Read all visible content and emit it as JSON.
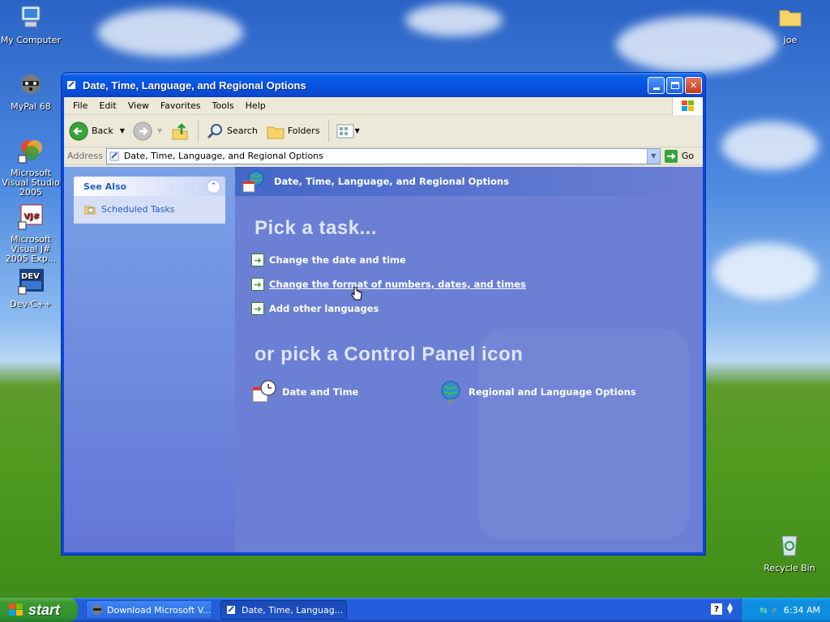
{
  "desktop": {
    "icons": [
      {
        "label": "My Computer"
      },
      {
        "label": "MyPal 68"
      },
      {
        "label": "Microsoft Visual Studio 2005"
      },
      {
        "label": "Microsoft Visual J# 2005 Exp..."
      },
      {
        "label": "Dev-C++"
      },
      {
        "label": "joe"
      },
      {
        "label": "Recycle Bin"
      }
    ]
  },
  "window": {
    "title": "Date, Time, Language, and Regional Options",
    "menu": [
      "File",
      "Edit",
      "View",
      "Favorites",
      "Tools",
      "Help"
    ],
    "toolbar": {
      "back": "Back",
      "search": "Search",
      "folders": "Folders"
    },
    "address": {
      "label": "Address",
      "value": "Date, Time, Language, and Regional Options",
      "go": "Go"
    },
    "see_also": {
      "title": "See Also",
      "items": [
        "Scheduled Tasks"
      ]
    },
    "main": {
      "header": "Date, Time, Language, and Regional Options",
      "pick_task": "Pick a task...",
      "tasks": [
        "Change the date and time",
        "Change the format of numbers, dates, and times",
        "Add other languages"
      ],
      "pick_icon": "or pick a Control Panel icon",
      "icons": [
        "Date and Time",
        "Regional and Language Options"
      ]
    }
  },
  "taskbar": {
    "start": "start",
    "buttons": [
      "Download Microsoft V...",
      "Date, Time, Languag..."
    ],
    "clock": "6:34 AM"
  }
}
